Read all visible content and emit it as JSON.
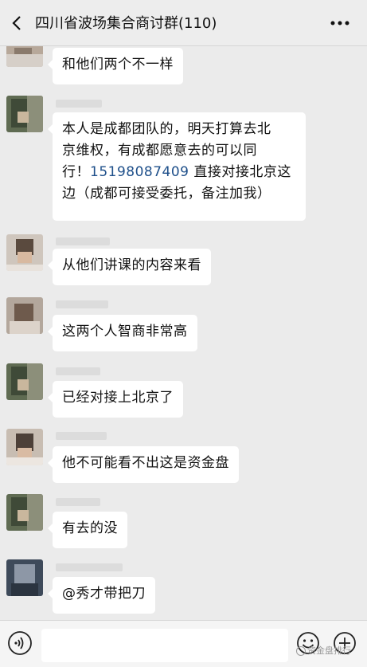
{
  "header": {
    "title": "四川省波场集合商讨群(110)",
    "back_icon": "chevron-left-icon",
    "more_icon": "more-horizontal-icon"
  },
  "messages": [
    {
      "text": "和他们两个不一样"
    },
    {
      "lines": [
        "本人是成都团队的，明天打算去北",
        "京维权，有成都愿意去的可以同",
        "行！",
        "15198087409",
        " 直接对接北京这",
        "边（成都可接受委托，备注加我）"
      ]
    },
    {
      "text": "从他们讲课的内容来看"
    },
    {
      "text": "这两个人智商非常高"
    },
    {
      "text": "已经对接上北京了"
    },
    {
      "text": "他不可能看不出这是资金盘"
    },
    {
      "text": "有去的没"
    },
    {
      "text": "@秀才带把刀"
    }
  ],
  "input_bar": {
    "voice_icon": "voice-icon",
    "emoji_icon": "emoji-icon",
    "plus_icon": "plus-icon",
    "input_value": ""
  },
  "watermark": {
    "text": "资金盘排行"
  },
  "colors": {
    "background": "#ebebeb",
    "bubble": "#ffffff",
    "phone_link": "#1e4f8a"
  }
}
